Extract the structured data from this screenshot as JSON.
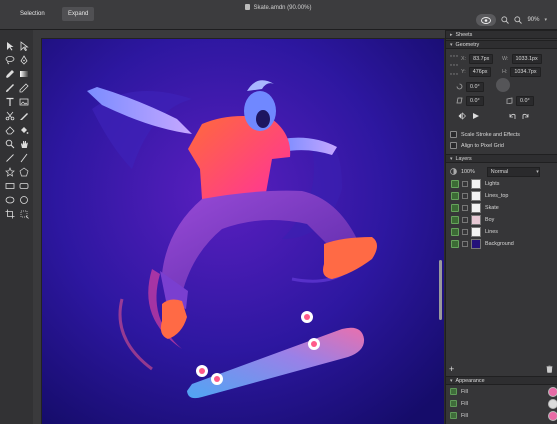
{
  "topbar": {
    "selection_label": "Selection",
    "expand_label": "Expand",
    "document_title": "Skate.amdn (90.00%)",
    "zoom_level": "90%"
  },
  "panel": {
    "sheets_label": "Sheets",
    "geometry_label": "Geometry",
    "geometry": {
      "x_label": "X:",
      "x_value": "83.7px",
      "w_label": "W:",
      "w_value": "1033.1px",
      "y_label": "Y:",
      "y_value": "476px",
      "h_label": "H:",
      "h_value": "1034.7px",
      "rotation": "0.0°",
      "skew_a": "0.0°",
      "skew_b": "0.0°"
    },
    "options": [
      {
        "label": "Scale Stroke and Effects",
        "checked": false
      },
      {
        "label": "Align to Pixel Grid",
        "checked": false
      }
    ],
    "layers_label": "Layers",
    "opacity": "100%",
    "blend_mode": "Normal",
    "layers": [
      {
        "name": "Lights",
        "thumb": "#f2f2f2"
      },
      {
        "name": "Lines_top",
        "thumb": "#f2f2f2"
      },
      {
        "name": "Skate",
        "thumb": "#f2f2f2"
      },
      {
        "name": "Boy",
        "thumb": "#e7c9d4"
      },
      {
        "name": "Lines",
        "thumb": "#f2f2f2"
      },
      {
        "name": "Background",
        "thumb": "#24127a"
      }
    ],
    "appearance_label": "Appearance",
    "appearance_items": [
      "Fill",
      "Fill",
      "Fill"
    ]
  },
  "colors": {
    "accent_green": "#5f9a58",
    "canvas_bg": "#2a1690"
  }
}
